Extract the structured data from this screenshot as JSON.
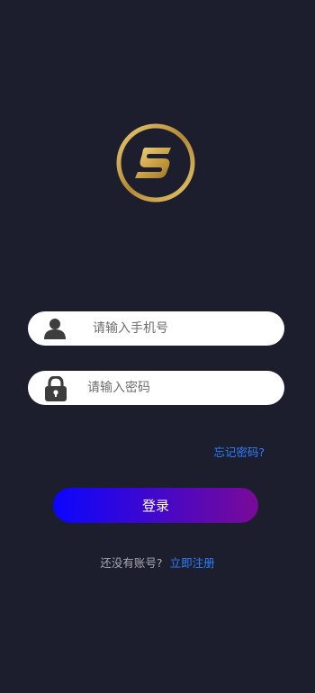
{
  "brand": {
    "logo_icon": "s-logo-icon",
    "accent_gold": "#c8a24a"
  },
  "login_form": {
    "phone_placeholder": "请输入手机号",
    "password_placeholder": "请输入密码",
    "phone_icon": "user-icon",
    "password_icon": "lock-icon"
  },
  "actions": {
    "forgot_password": "忘记密码?",
    "login": "登录",
    "register_prompt": "还没有账号?",
    "register_link": "立即注册"
  },
  "colors": {
    "background": "#1c1e2e",
    "link": "#2f7fff",
    "button_gradient_start": "#0b05ff",
    "button_gradient_end": "#7a0a96"
  }
}
